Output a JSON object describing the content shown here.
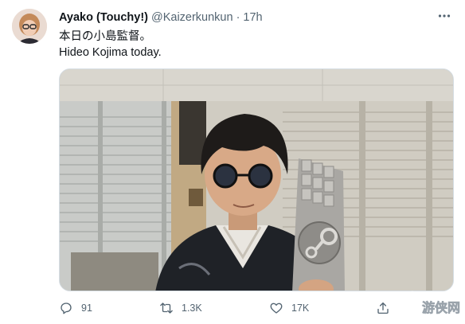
{
  "tweet": {
    "author_name": "Ayako (Touchy!)",
    "handle": "@Kaizerkunkun",
    "separator": "·",
    "time": "17h",
    "text_lines": [
      "本日の小島監督。",
      "Hideo Kojima today."
    ]
  },
  "icons": {
    "more": "more-horizontal-icon",
    "reply": "reply-icon",
    "retweet": "retweet-icon",
    "like": "heart-icon",
    "share": "share-icon"
  },
  "actions": {
    "reply_count": "91",
    "retweet_count": "1.3K",
    "like_count": "17K"
  },
  "watermark": {
    "text": "游侠网"
  },
  "colors": {
    "text": "#0f1419",
    "secondary": "#536471",
    "border": "#d5dde3"
  }
}
